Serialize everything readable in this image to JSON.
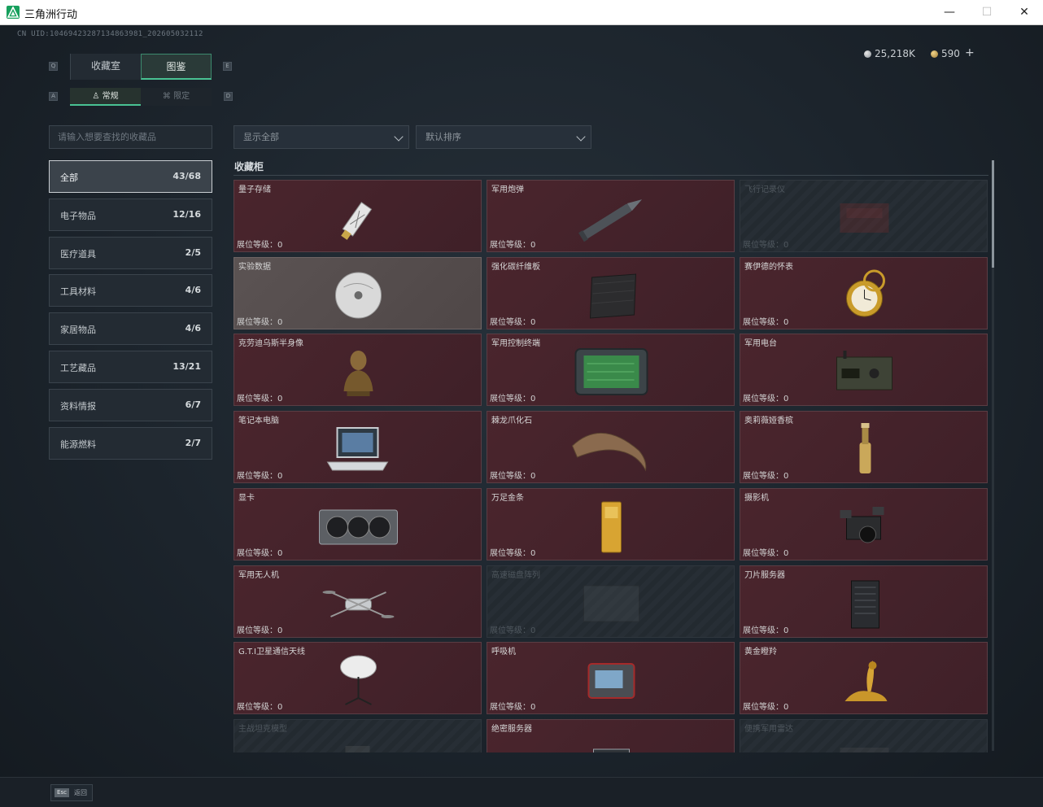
{
  "window": {
    "title": "三角洲行动",
    "min": "—",
    "max": "☐",
    "close": "✕"
  },
  "uid": "CN UID:10469423287134863981_202605032112",
  "currency": {
    "silver": "25,218K",
    "gold": "590",
    "plus": "+"
  },
  "tabs": {
    "main": [
      {
        "label": "收藏室",
        "active": false
      },
      {
        "label": "图鉴",
        "active": true
      }
    ],
    "sub": [
      {
        "label": "常规",
        "active": true
      },
      {
        "label": "限定",
        "active": false
      }
    ],
    "hint_left": "Q",
    "hint_right": "E",
    "hint_sub_left": "A",
    "hint_sub_right": "D"
  },
  "search": {
    "placeholder": "请输入想要查找的收藏品"
  },
  "filters": {
    "show": "显示全部",
    "sort": "默认排序"
  },
  "categories": [
    {
      "label": "全部",
      "count": "43/68",
      "active": true
    },
    {
      "label": "电子物品",
      "count": "12/16"
    },
    {
      "label": "医疗道具",
      "count": "2/5"
    },
    {
      "label": "工具材料",
      "count": "4/6"
    },
    {
      "label": "家居物品",
      "count": "4/6"
    },
    {
      "label": "工艺藏品",
      "count": "13/21"
    },
    {
      "label": "资料情报",
      "count": "6/7"
    },
    {
      "label": "能源燃料",
      "count": "2/7"
    }
  ],
  "section": {
    "title": "收藏柜"
  },
  "level_prefix": "展位等级：",
  "items": [
    {
      "name": "量子存储",
      "level": "展位等级：0",
      "state": "owned",
      "icon": "usb-drive-icon"
    },
    {
      "name": "军用炮弹",
      "level": "展位等级：0",
      "state": "owned",
      "icon": "artillery-shell-icon"
    },
    {
      "name": "飞行记录仪",
      "level": "展位等级：0",
      "state": "locked",
      "icon": "flight-recorder-icon"
    },
    {
      "name": "实验数据",
      "level": "展位等级：0",
      "state": "grey",
      "icon": "disc-icon"
    },
    {
      "name": "强化碳纤维板",
      "level": "展位等级：0",
      "state": "owned",
      "icon": "carbon-plate-icon"
    },
    {
      "name": "赛伊德的怀表",
      "level": "展位等级：0",
      "state": "owned",
      "icon": "pocket-watch-icon"
    },
    {
      "name": "克劳迪乌斯半身像",
      "level": "展位等级：0",
      "state": "owned",
      "icon": "bust-icon"
    },
    {
      "name": "军用控制终端",
      "level": "展位等级：0",
      "state": "owned",
      "icon": "terminal-icon"
    },
    {
      "name": "军用电台",
      "level": "展位等级：0",
      "state": "owned",
      "icon": "radio-icon"
    },
    {
      "name": "笔记本电脑",
      "level": "展位等级：0",
      "state": "owned",
      "icon": "laptop-icon"
    },
    {
      "name": "棘龙爪化石",
      "level": "展位等级：0",
      "state": "owned",
      "icon": "claw-fossil-icon"
    },
    {
      "name": "奥莉薇娅香槟",
      "level": "展位等级：0",
      "state": "owned",
      "icon": "champagne-icon"
    },
    {
      "name": "显卡",
      "level": "展位等级：0",
      "state": "owned",
      "icon": "gpu-icon"
    },
    {
      "name": "万足金条",
      "level": "展位等级：0",
      "state": "owned",
      "icon": "gold-bar-icon"
    },
    {
      "name": "摄影机",
      "level": "展位等级：0",
      "state": "owned",
      "icon": "camera-icon"
    },
    {
      "name": "军用无人机",
      "level": "展位等级：0",
      "state": "owned",
      "icon": "drone-icon"
    },
    {
      "name": "高速磁盘阵列",
      "level": "展位等级：0",
      "state": "locked",
      "icon": "disk-array-icon"
    },
    {
      "name": "刀片服务器",
      "level": "展位等级：0",
      "state": "owned",
      "icon": "server-icon"
    },
    {
      "name": "G.T.I卫星通信天线",
      "level": "展位等级：0",
      "state": "owned",
      "icon": "satellite-dish-icon"
    },
    {
      "name": "呼吸机",
      "level": "展位等级：0",
      "state": "owned",
      "icon": "ventilator-icon"
    },
    {
      "name": "黄金瞪羚",
      "level": "展位等级：0",
      "state": "owned",
      "icon": "gazelle-icon"
    },
    {
      "name": "主战坦克模型",
      "level": "",
      "state": "locked",
      "icon": "tank-model-icon"
    },
    {
      "name": "绝密服务器",
      "level": "",
      "state": "owned",
      "icon": "secret-server-icon"
    },
    {
      "name": "便携军用雷达",
      "level": "",
      "state": "locked",
      "icon": "radar-icon"
    }
  ],
  "bottom": {
    "esc_key": "Esc",
    "esc_label": "返回"
  }
}
